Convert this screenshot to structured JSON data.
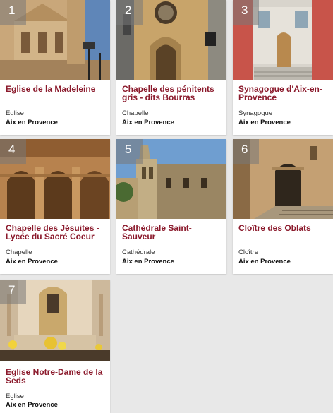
{
  "cards": [
    {
      "number": "1",
      "title": "Eglise de la Madeleine",
      "type": "Eglise",
      "city": "Aix en Provence"
    },
    {
      "number": "2",
      "title": "Chapelle des pénitents gris - dits Bourras",
      "type": "Chapelle",
      "city": "Aix en Provence"
    },
    {
      "number": "3",
      "title": "Synagogue d'Aix-en-Provence",
      "type": "Synagogue",
      "city": "Aix en Provence"
    },
    {
      "number": "4",
      "title": "Chapelle des Jésuites - Lycée du Sacré Coeur",
      "type": "Chapelle",
      "city": "Aix en Provence"
    },
    {
      "number": "5",
      "title": "Cathédrale Saint-Sauveur",
      "type": "Cathédrale",
      "city": "Aix en Provence"
    },
    {
      "number": "6",
      "title": "Cloître des Oblats",
      "type": "Cloître",
      "city": "Aix en Provence"
    },
    {
      "number": "7",
      "title": "Eglise Notre-Dame de la Seds",
      "type": "Eglise",
      "city": "Aix en Provence"
    }
  ],
  "colors": {
    "title": "#8b1a2c",
    "background": "#e8e8e8"
  }
}
